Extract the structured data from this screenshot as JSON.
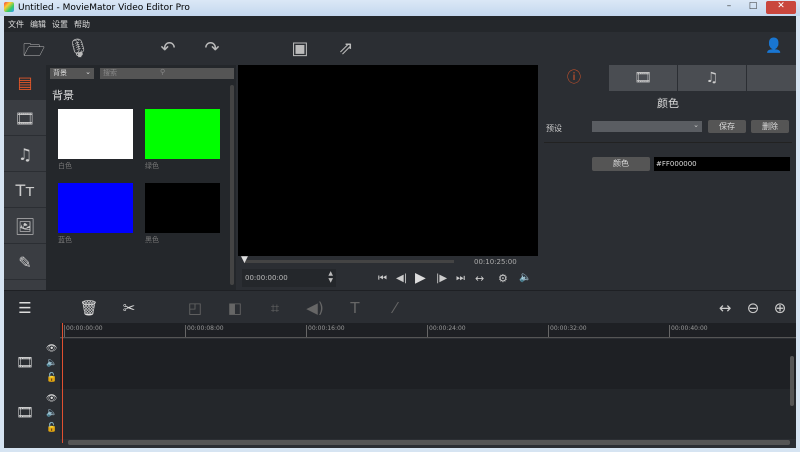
{
  "window": {
    "title": "Untitled - MovieMator Video Editor Pro"
  },
  "menu": [
    "文件",
    "编辑",
    "设置",
    "帮助"
  ],
  "library": {
    "category": "背景",
    "search_placeholder": "搜索",
    "heading": "背景",
    "items": [
      {
        "label": "白色",
        "color": "#FFFFFF"
      },
      {
        "label": "绿色",
        "color": "#00FF00"
      },
      {
        "label": "蓝色",
        "color": "#0000FF"
      },
      {
        "label": "黑色",
        "color": "#000000"
      }
    ]
  },
  "player": {
    "duration": "00:10:25:00",
    "position": "00:00:00:00"
  },
  "properties": {
    "title": "颜色",
    "preset_label": "预设",
    "preset_value": "",
    "save": "保存",
    "delete": "删除",
    "color_button": "颜色",
    "color_value": "#FF000000"
  },
  "timeline": {
    "ticks": [
      "00:00:00:00",
      "00:00:08:00",
      "00:00:16:00",
      "00:00:24:00",
      "00:00:32:00",
      "00:00:40:00"
    ],
    "playhead_color": "#e05030"
  },
  "accent": "#e0572a"
}
